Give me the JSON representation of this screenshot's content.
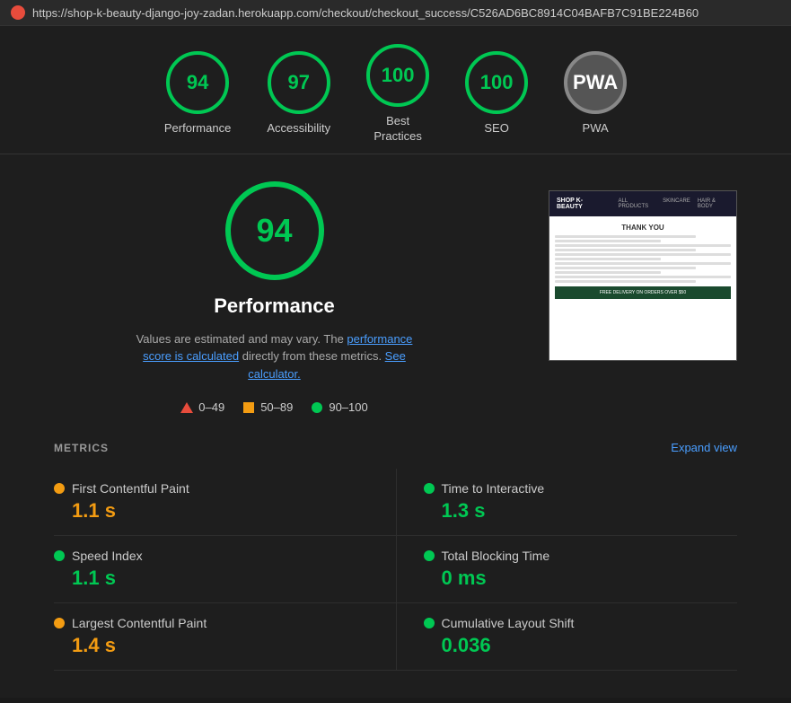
{
  "topbar": {
    "url": "https://shop-k-beauty-django-joy-zadan.herokuapp.com/checkout/checkout_success/C526AD6BC8914C04BAFB7C91BE224B60"
  },
  "scores": [
    {
      "id": "performance",
      "value": "94",
      "label": "Performance",
      "color": "green"
    },
    {
      "id": "accessibility",
      "value": "97",
      "label": "Accessibility",
      "color": "green"
    },
    {
      "id": "best-practices",
      "value": "100",
      "label": "Best\nPractices",
      "color": "green"
    },
    {
      "id": "seo",
      "value": "100",
      "label": "SEO",
      "color": "green"
    },
    {
      "id": "pwa",
      "value": "—",
      "label": "PWA",
      "color": "grey"
    }
  ],
  "performance": {
    "score": "94",
    "title": "Performance",
    "description": "Values are estimated and may vary. The",
    "link1": "performance score is calculated",
    "description2": "directly from these metrics.",
    "link2": "See calculator.",
    "legend": [
      {
        "id": "fail",
        "range": "0–49",
        "type": "triangle"
      },
      {
        "id": "average",
        "range": "50–89",
        "type": "square-orange"
      },
      {
        "id": "pass",
        "range": "90–100",
        "type": "circle-green"
      }
    ]
  },
  "metrics": {
    "title": "METRICS",
    "expand_label": "Expand view",
    "items": [
      {
        "id": "fcp",
        "name": "First Contentful Paint",
        "value": "1.1 s",
        "color": "orange",
        "dot": "orange"
      },
      {
        "id": "tti",
        "name": "Time to Interactive",
        "value": "1.3 s",
        "color": "green",
        "dot": "green"
      },
      {
        "id": "si",
        "name": "Speed Index",
        "value": "1.1 s",
        "color": "green",
        "dot": "green"
      },
      {
        "id": "tbt",
        "name": "Total Blocking Time",
        "value": "0 ms",
        "color": "green",
        "dot": "green"
      },
      {
        "id": "lcp",
        "name": "Largest Contentful Paint",
        "value": "1.4 s",
        "color": "orange",
        "dot": "orange"
      },
      {
        "id": "cls",
        "name": "Cumulative Layout Shift",
        "value": "0.036",
        "color": "green",
        "dot": "green"
      }
    ]
  },
  "thumb": {
    "shop_name": "SHOP K-BEAUTY",
    "nav_items": [
      "ALL PRODUCTS",
      "SKINCARE",
      "HAIR & BODY"
    ],
    "thank_you": "THANK YOU",
    "order_label": "Your order confirmation and details will be sent to",
    "footer_text": "FREE DELIVERY ON ORDERS OVER $50"
  }
}
